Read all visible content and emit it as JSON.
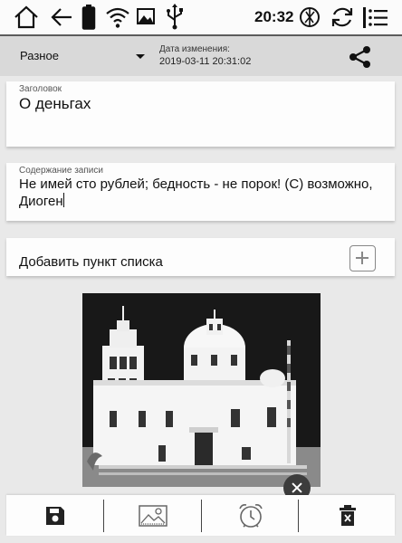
{
  "status_bar": {
    "time": "20:32",
    "icons": [
      "home-icon",
      "back-icon",
      "battery-icon",
      "wifi-icon",
      "image-icon",
      "usb-icon",
      "refresh-sync-icon",
      "rotate-icon",
      "menu-icon"
    ]
  },
  "toolbar": {
    "category": "Разное",
    "date_caption": "Дата изменения:",
    "date_value": "2019-03-11 20:31:02",
    "share_icon": "share-icon"
  },
  "note": {
    "title_caption": "Заголовок",
    "title_value": "О деньгах",
    "content_caption": "Содержание записи",
    "content_value": "Не имей сто рублей; бедность - не порок! (С) возможно, Диоген"
  },
  "checklist": {
    "add_label": "Добавить пункт списка",
    "add_icon": "plus-icon"
  },
  "attachment": {
    "image": "church-photo",
    "remove_icon": "close-icon"
  },
  "bottom_bar": {
    "icons": [
      "save-icon",
      "insert-image-icon",
      "alarm-clock-icon",
      "delete-icon"
    ]
  }
}
